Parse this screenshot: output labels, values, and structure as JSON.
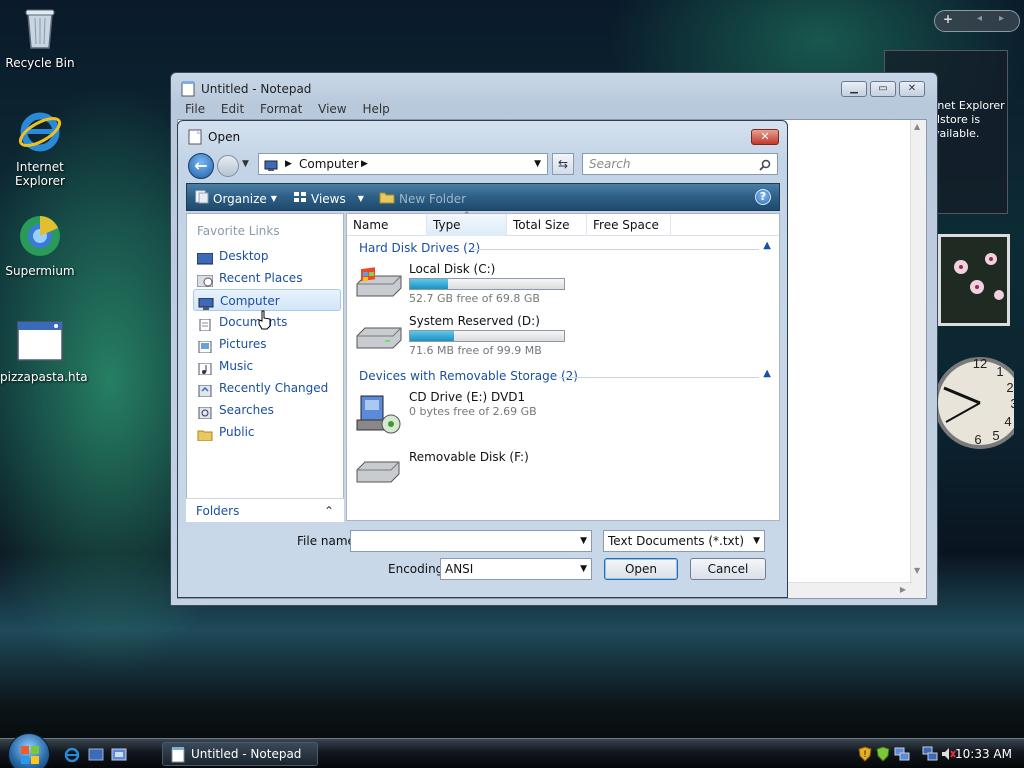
{
  "desktop": {
    "icons": [
      {
        "label": "Recycle Bin"
      },
      {
        "label": "Internet Explorer"
      },
      {
        "label": "Supermium"
      },
      {
        "label": "pizzapasta.hta"
      }
    ]
  },
  "gadget": {
    "text": "rnet Explorer dstore is vailable."
  },
  "notepad": {
    "title": "Untitled - Notepad",
    "menu": [
      "File",
      "Edit",
      "Format",
      "View",
      "Help"
    ]
  },
  "dialog": {
    "title": "Open",
    "address": "Computer",
    "search_placeholder": "Search",
    "toolbar": {
      "organize": "Organize",
      "views": "Views",
      "new_folder": "New Folder"
    },
    "nav": {
      "header": "Favorite Links",
      "items": [
        "Desktop",
        "Recent Places",
        "Computer",
        "Documents",
        "Pictures",
        "Music",
        "Recently Changed",
        "Searches",
        "Public"
      ],
      "selected": "Computer",
      "folders": "Folders"
    },
    "columns": [
      "Name",
      "Type",
      "Total Size",
      "Free Space"
    ],
    "groups": [
      {
        "title": "Hard Disk Drives (2)",
        "drives": [
          {
            "name": "Local Disk (C:)",
            "free": "52.7 GB free of 69.8 GB",
            "used_fraction": 0.245
          },
          {
            "name": "System Reserved (D:)",
            "free": "71.6 MB free of 99.9 MB",
            "used_fraction": 0.283
          }
        ]
      },
      {
        "title": "Devices with Removable Storage (2)",
        "drives": [
          {
            "name": "CD Drive (E:) DVD1",
            "free": "0 bytes free of 2.69 GB"
          },
          {
            "name": "Removable Disk (F:)",
            "free": ""
          }
        ]
      }
    ],
    "filename_label": "File name:",
    "filename_value": "",
    "filetype": "Text Documents (*.txt)",
    "encoding_label": "Encoding:",
    "encoding": "ANSI",
    "open_button": "Open",
    "cancel_button": "Cancel"
  },
  "taskbar": {
    "task": "Untitled - Notepad",
    "time": "10:33 AM"
  },
  "colors": {
    "accent": "#1b4fa3",
    "drive_fill": "#1c8fc4",
    "toolbar": "#2d5f86"
  }
}
